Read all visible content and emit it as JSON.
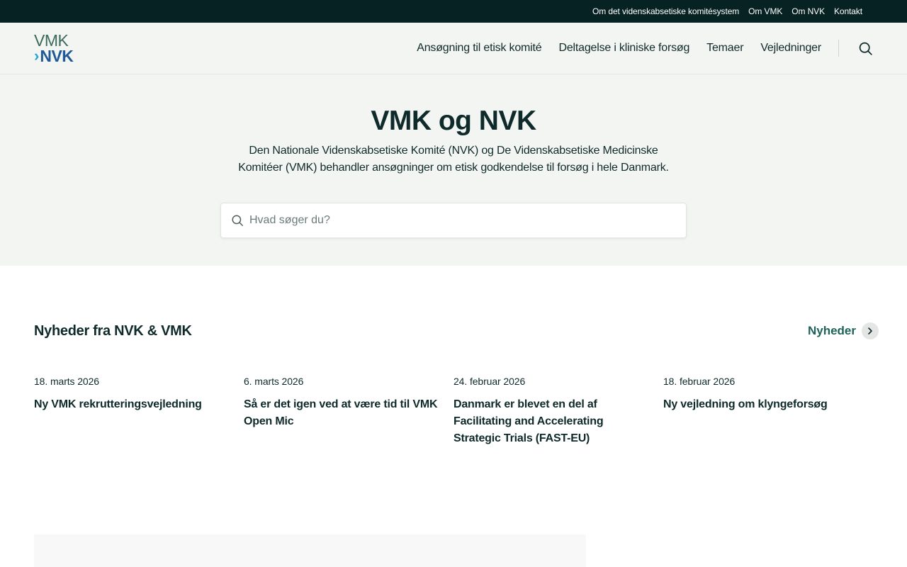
{
  "topbar": {
    "links": [
      "Om det videnskabsetiske komitésystem",
      "Om VMK",
      "Om NVK",
      "Kontakt"
    ]
  },
  "logo": {
    "line1": "VMK",
    "chevron": "›",
    "line2": "NVK"
  },
  "nav": {
    "items": [
      "Ansøgning til etisk komité",
      "Deltagelse i kliniske forsøg",
      "Temaer",
      "Vejledninger"
    ],
    "search_icon": "search-icon"
  },
  "hero": {
    "title": "VMK og NVK",
    "description": "Den Nationale Videnskabsetiske Komité (NVK) og De Videnskabsetiske Medicinske Komitéer (VMK) behandler ansøgninger om etisk godkendelse til forsøg i hele Danmark.",
    "search_placeholder": "Hvad søger du?"
  },
  "news": {
    "heading": "Nyheder fra NVK & VMK",
    "link_label": "Nyheder",
    "items": [
      {
        "date": "18. marts 2026",
        "title": "Ny VMK rekrutteringsvejledning"
      },
      {
        "date": "6. marts 2026",
        "title": "Så er det igen ved at være tid til VMK Open Mic"
      },
      {
        "date": "24. februar 2026",
        "title": "Danmark er blevet en del af Facilitating and Accelerating Strategic Trials (FAST-EU)"
      },
      {
        "date": "18. februar 2026",
        "title": "Ny vejledning om klyngeforsøg"
      }
    ]
  },
  "colors": {
    "topbar_bg": "#062223",
    "hero_bg": "#f3f5f2",
    "text": "#0f2a2a",
    "accent_green": "#1d6359",
    "logo_blue": "#1f5a96",
    "logo_cyan": "#26a3d9"
  }
}
